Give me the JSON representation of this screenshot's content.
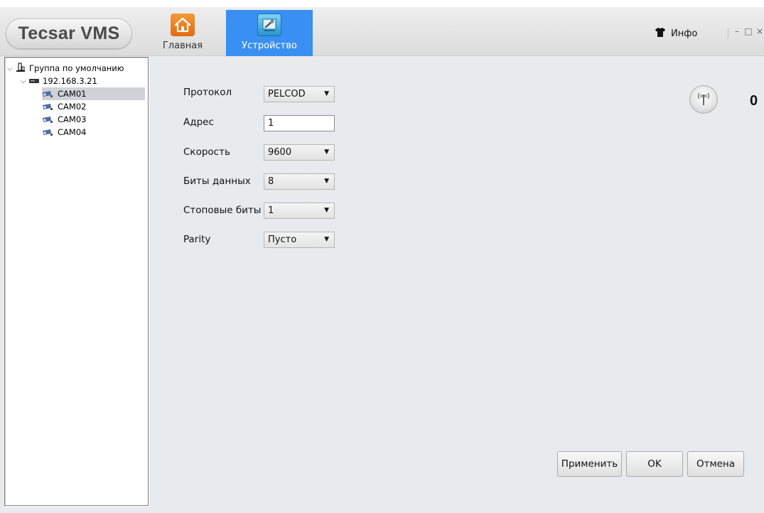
{
  "app": {
    "logo": "Tecsar VMS"
  },
  "nav": {
    "home_label": "Главная",
    "device_label": "Устройство",
    "info_label": "Инфо"
  },
  "window_controls": {
    "minimize": "–",
    "maximize": "□",
    "close": "×"
  },
  "tree": {
    "group": "Группа по умолчанию",
    "device": "192.168.3.21",
    "cameras": [
      "CAM01",
      "CAM02",
      "CAM03",
      "CAM04"
    ],
    "selected": "CAM01"
  },
  "form": {
    "protocol_label": "Протокол",
    "protocol_value": "PELCOD",
    "address_label": "Адрес",
    "address_value": "1",
    "speed_label": "Скорость",
    "speed_value": "9600",
    "databits_label": "Биты данных",
    "databits_value": "8",
    "stopbits_label": "Стоповые биты",
    "stopbits_value": "1",
    "parity_label": "Parity",
    "parity_value": "Пусто"
  },
  "ptz": {
    "value": "0"
  },
  "buttons": {
    "apply": "Применить",
    "ok": "OK",
    "cancel": "Отмена"
  },
  "colors": {
    "accent": "#3a8ff2",
    "home_icon": "#e46a12",
    "background": "#e9eaec"
  }
}
